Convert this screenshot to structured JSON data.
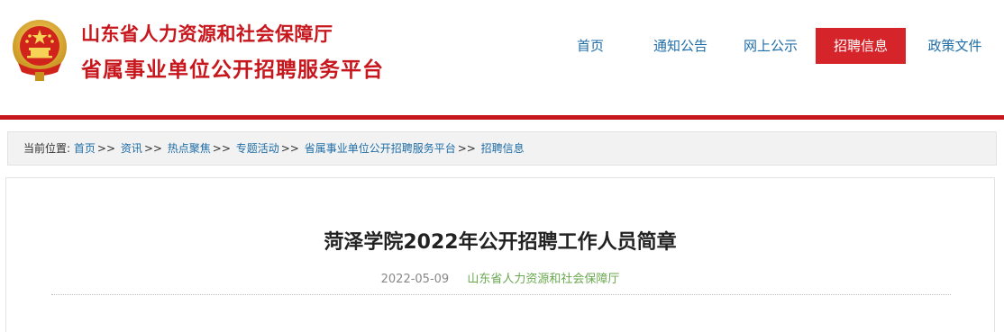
{
  "header": {
    "site_name_line1": "山东省人力资源和社会保障厅",
    "site_name_line2": "省属事业单位公开招聘服务平台",
    "emblem_icon": "national-emblem-icon",
    "brand_color": "#c8161d"
  },
  "nav": {
    "items": [
      {
        "label": "首页"
      },
      {
        "label": "通知公告"
      },
      {
        "label": "网上公示"
      },
      {
        "label": "招聘信息",
        "active": true
      },
      {
        "label": "政策文件"
      }
    ],
    "active_color": "#d5242a"
  },
  "breadcrumb": {
    "prefix": "当前位置:",
    "items": [
      "首页",
      "资讯",
      "热点聚焦",
      "专题活动",
      "省属事业单位公开招聘服务平台",
      "招聘信息"
    ],
    "separator": ">>"
  },
  "article": {
    "title": "菏泽学院2022年公开招聘工作人员简章",
    "date": "2022-05-09",
    "source": "山东省人力资源和社会保障厅"
  }
}
